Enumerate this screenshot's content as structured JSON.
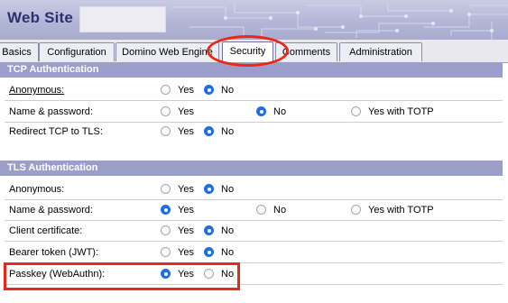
{
  "header": {
    "title": "Web Site"
  },
  "tabs": [
    {
      "label": "Basics",
      "active": false
    },
    {
      "label": "Configuration",
      "active": false
    },
    {
      "label": "Domino Web Engine",
      "active": false
    },
    {
      "label": "Security",
      "active": true
    },
    {
      "label": "Comments",
      "active": false
    },
    {
      "label": "Administration",
      "active": false
    }
  ],
  "tcp": {
    "title": "TCP Authentication",
    "rows": [
      {
        "label": "Anonymous:",
        "options": [
          "Yes",
          "No"
        ],
        "selected": "No"
      },
      {
        "label": "Name & password:",
        "options": [
          "Yes",
          "No",
          "Yes with TOTP"
        ],
        "selected": "No"
      },
      {
        "label": "Redirect TCP to TLS:",
        "options": [
          "Yes",
          "No"
        ],
        "selected": "No"
      }
    ]
  },
  "tls": {
    "title": "TLS Authentication",
    "rows": [
      {
        "label": "Anonymous:",
        "options": [
          "Yes",
          "No"
        ],
        "selected": "No"
      },
      {
        "label": "Name & password:",
        "options": [
          "Yes",
          "No",
          "Yes with TOTP"
        ],
        "selected": "Yes"
      },
      {
        "label": "Client certificate:",
        "options": [
          "Yes",
          "No"
        ],
        "selected": "No"
      },
      {
        "label": "Bearer token (JWT):",
        "options": [
          "Yes",
          "No"
        ],
        "selected": "No"
      },
      {
        "label": "Passkey (WebAuthn):",
        "options": [
          "Yes",
          "No"
        ],
        "selected": "Yes"
      }
    ]
  },
  "colors": {
    "section_header": "#9b9ec9",
    "radio_selected": "#1f6fdf",
    "annotation": "#e8281a",
    "banner_title": "#2c3170"
  }
}
